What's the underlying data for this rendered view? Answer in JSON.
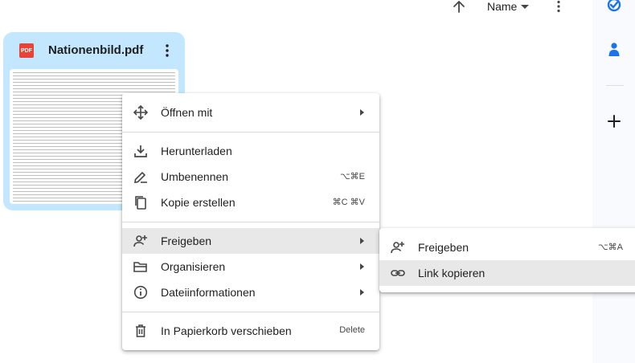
{
  "toolbar": {
    "sort_label": "Name",
    "sort_direction_icon": "arrow-up-icon",
    "more_icon": "more-vert-icon"
  },
  "file_card": {
    "file_type": "PDF",
    "title": "Nationenbild.pdf"
  },
  "context_menu": {
    "items": [
      {
        "label": "Öffnen mit",
        "icon": "open-with-icon",
        "shortcut": "",
        "submenu": true
      },
      {
        "label": "Herunterladen",
        "icon": "download-icon",
        "shortcut": "",
        "submenu": false
      },
      {
        "label": "Umbenennen",
        "icon": "rename-icon",
        "shortcut": "⌥⌘E",
        "submenu": false
      },
      {
        "label": "Kopie erstellen",
        "icon": "copy-icon",
        "shortcut": "⌘C ⌘V",
        "submenu": false
      },
      {
        "label": "Freigeben",
        "icon": "person-add-icon",
        "shortcut": "",
        "submenu": true
      },
      {
        "label": "Organisieren",
        "icon": "folder-open-icon",
        "shortcut": "",
        "submenu": true
      },
      {
        "label": "Dateiinformationen",
        "icon": "info-icon",
        "shortcut": "",
        "submenu": true
      },
      {
        "label": "In Papierkorb verschieben",
        "icon": "trash-icon",
        "shortcut": "Delete",
        "submenu": false
      }
    ]
  },
  "share_submenu": {
    "items": [
      {
        "label": "Freigeben",
        "icon": "person-add-icon",
        "shortcut": "⌥⌘A"
      },
      {
        "label": "Link kopieren",
        "icon": "link-icon",
        "shortcut": ""
      }
    ]
  },
  "colors": {
    "card_selected": "#c2e7ff",
    "menu_hover": "#e8e8e8",
    "pdf_red": "#ea4335",
    "tasks_blue": "#1a73e8"
  }
}
